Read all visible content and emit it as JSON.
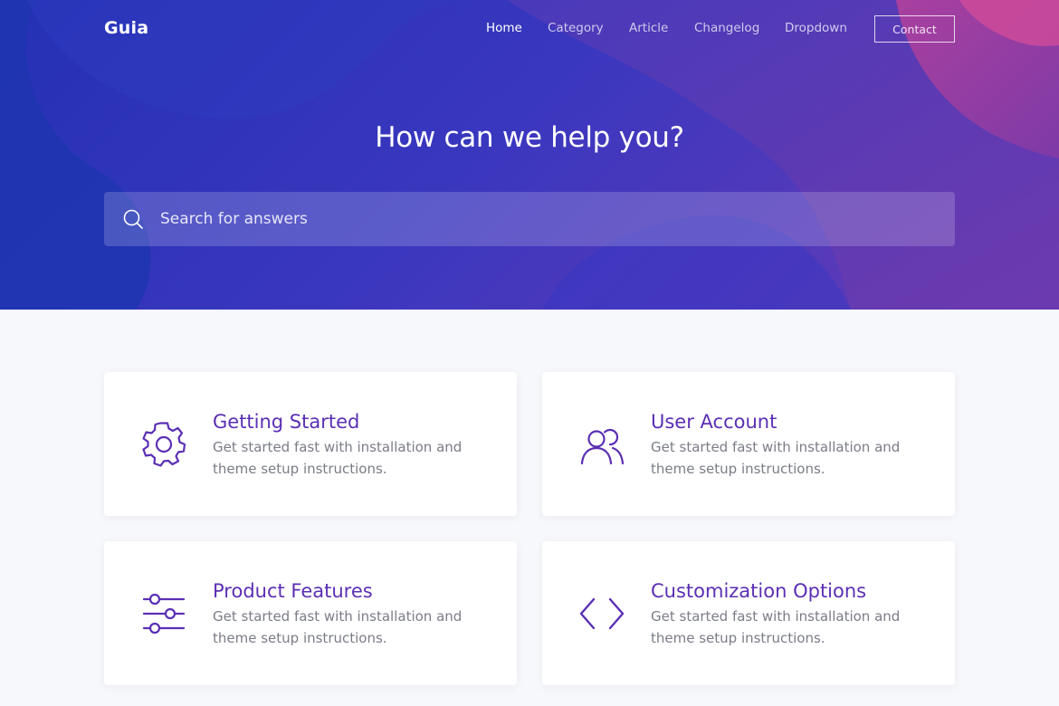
{
  "brand": "Guia",
  "nav": {
    "items": [
      {
        "label": "Home",
        "active": true
      },
      {
        "label": "Category",
        "active": false
      },
      {
        "label": "Article",
        "active": false
      },
      {
        "label": "Changelog",
        "active": false
      },
      {
        "label": "Dropdown",
        "active": false
      }
    ],
    "contact_label": "Contact"
  },
  "hero": {
    "title": "How can we help you?",
    "search_placeholder": "Search for answers",
    "search_icon": "search-icon"
  },
  "cards": [
    {
      "title": "Getting Started",
      "description": "Get started fast with installation and theme setup instructions.",
      "icon": "gear-icon"
    },
    {
      "title": "User Account",
      "description": "Get started fast with installation and theme setup instructions.",
      "icon": "users-icon"
    },
    {
      "title": "Product Features",
      "description": "Get started fast with installation and theme setup instructions.",
      "icon": "sliders-icon"
    },
    {
      "title": "Customization Options",
      "description": "Get started fast with installation and theme setup instructions.",
      "icon": "code-icon"
    }
  ],
  "colors": {
    "hero_blue": "#2a33b6",
    "hero_purple": "#6b3cae",
    "hero_pink": "#c2459c",
    "accent": "#5b2fb4",
    "page_background": "#f7f8fb",
    "body_text": "#7a7d86"
  }
}
